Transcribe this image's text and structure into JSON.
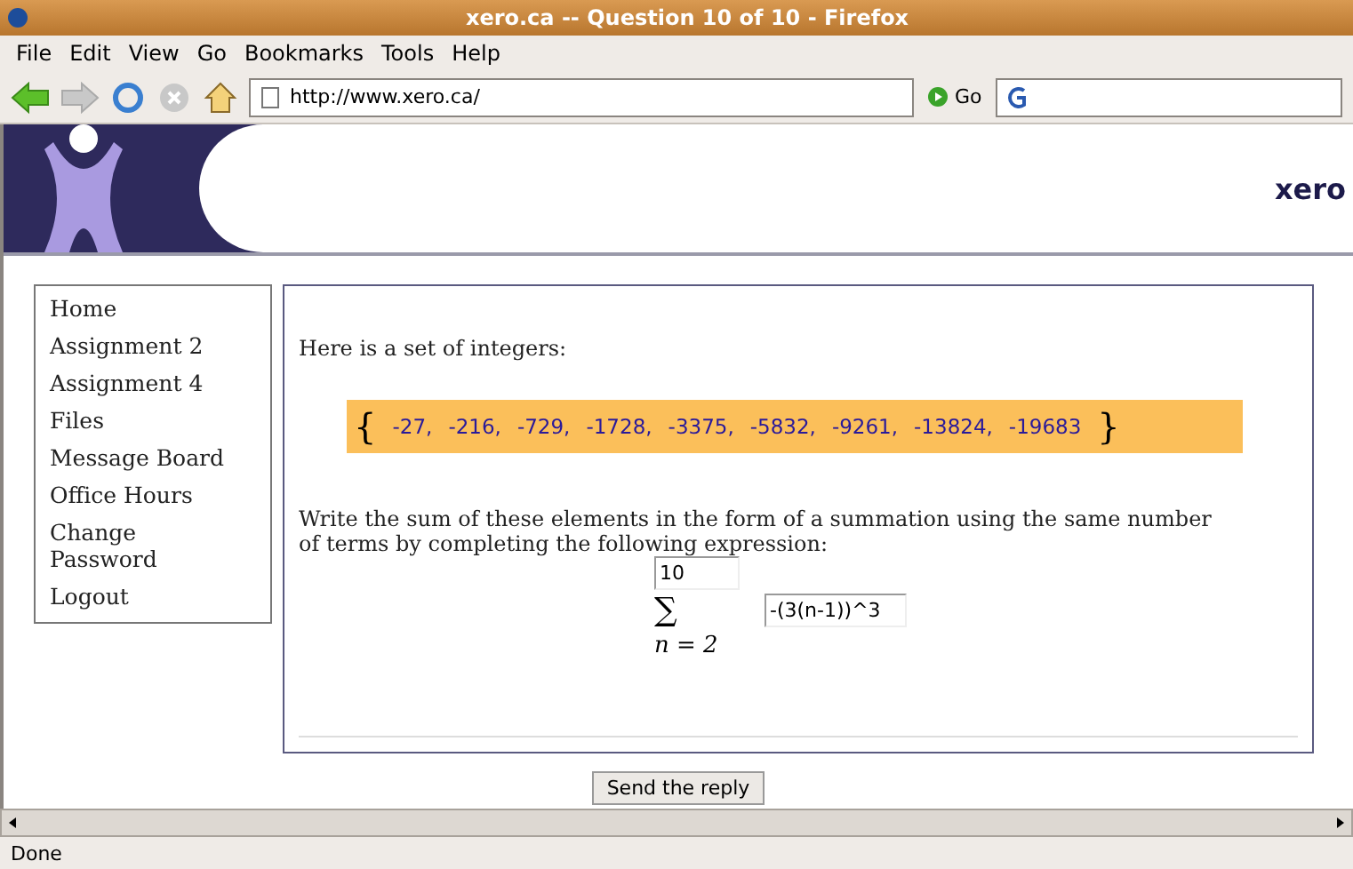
{
  "window": {
    "title": "xero.ca -- Question 10 of 10 - Firefox"
  },
  "menu": [
    "File",
    "Edit",
    "View",
    "Go",
    "Bookmarks",
    "Tools",
    "Help"
  ],
  "address": {
    "value": "http://www.xero.ca/"
  },
  "go_button": "Go",
  "banner": {
    "site_name": "xero"
  },
  "sidebar": {
    "items": [
      {
        "label": "Home"
      },
      {
        "label": "Assignment 2"
      },
      {
        "label": "Assignment 4"
      },
      {
        "label": "Files"
      },
      {
        "label": "Message Board"
      },
      {
        "label": "Office Hours"
      },
      {
        "label": "Change Password"
      },
      {
        "label": "Logout"
      }
    ]
  },
  "question": {
    "intro": "Here is a set of integers:",
    "open_brace": "{",
    "close_brace": "}",
    "integers": [
      "-27,",
      "-216,",
      "-729,",
      "-1728,",
      "-3375,",
      "-5832,",
      "-9261,",
      "-13824,",
      "-19683"
    ],
    "instruction": "Write the sum of these elements in the form of a summation using the same number of terms by completing the following expression:",
    "upper_limit": "10",
    "sigma": "∑",
    "term": "-(3(n-1))^3",
    "lower_limit": "n = 2"
  },
  "submit_button": "Send the reply",
  "status_bar": "Done"
}
